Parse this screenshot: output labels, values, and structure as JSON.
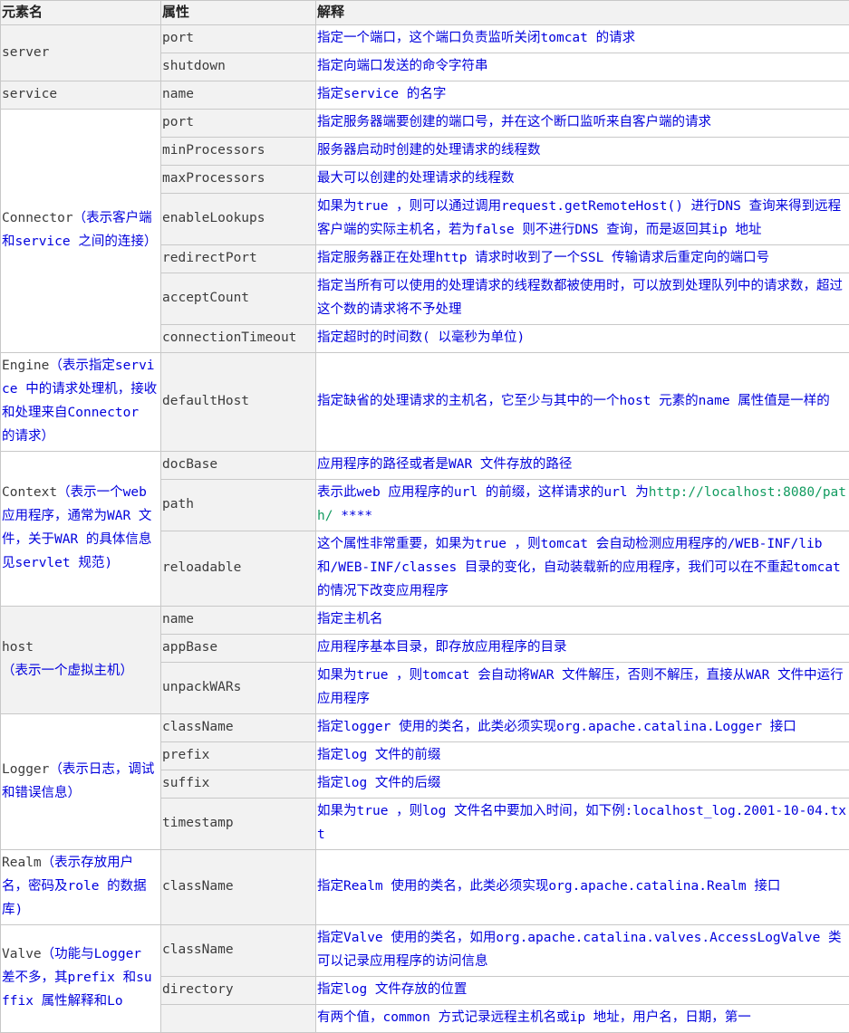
{
  "headers": [
    "元素名",
    "属性",
    "解释"
  ],
  "groups": [
    {
      "element_name": "server",
      "element_note": "",
      "shade": true,
      "rows": [
        {
          "attr": "port",
          "desc": [
            {
              "t": "指定一个端口，这个端口负责监听关闭tomcat 的请求"
            }
          ]
        },
        {
          "attr": "shutdown",
          "desc": [
            {
              "t": "指定向端口发送的命令字符串"
            }
          ]
        }
      ]
    },
    {
      "element_name": "service",
      "element_note": "",
      "shade": true,
      "rows": [
        {
          "attr": "name",
          "desc": [
            {
              "t": "指定service 的名字"
            }
          ]
        }
      ]
    },
    {
      "element_name": "Connector",
      "element_note": "（表示客户端和service 之间的连接）",
      "shade": false,
      "rows": [
        {
          "attr": "port",
          "desc": [
            {
              "t": "指定服务器端要创建的端口号，并在这个断口监听来自客户端的请求"
            }
          ]
        },
        {
          "attr": "minProcessors",
          "desc": [
            {
              "t": "服务器启动时创建的处理请求的线程数"
            }
          ]
        },
        {
          "attr": "maxProcessors",
          "desc": [
            {
              "t": "最大可以创建的处理请求的线程数"
            }
          ]
        },
        {
          "attr": "enableLookups",
          "desc": [
            {
              "t": "如果为true ，则可以通过调用request.getRemoteHost() 进行DNS 查询来得到远程客户端的实际主机名，若为false 则不进行DNS 查询，而是返回其ip 地址"
            }
          ]
        },
        {
          "attr": "redirectPort",
          "desc": [
            {
              "t": "指定服务器正在处理http 请求时收到了一个SSL 传输请求后重定向的端口号"
            }
          ]
        },
        {
          "attr": "acceptCount",
          "desc": [
            {
              "t": "指定当所有可以使用的处理请求的线程数都被使用时，可以放到处理队列中的请求数，超过这个数的请求将不予处理"
            }
          ]
        },
        {
          "attr": "connectionTimeout",
          "desc": [
            {
              "t": "指定超时的时间数( 以毫秒为单位)"
            }
          ]
        }
      ]
    },
    {
      "element_name": "Engine",
      "element_note": "（表示指定service 中的请求处理机，接收和处理来自Connector 的请求）",
      "shade": false,
      "rows": [
        {
          "attr": "defaultHost",
          "desc": [
            {
              "t": "指定缺省的处理请求的主机名，它至少与其中的一个host 元素的name 属性值是一样的"
            }
          ]
        }
      ]
    },
    {
      "element_name": "Context",
      "element_note": "（表示一个web 应用程序，通常为WAR 文件，关于WAR 的具体信息见servlet 规范)",
      "shade": false,
      "rows": [
        {
          "attr": "docBase",
          "desc": [
            {
              "t": "应用程序的路径或者是WAR 文件存放的路径"
            }
          ]
        },
        {
          "attr": "path",
          "desc": [
            {
              "t": "表示此web 应用程序的url 的前缀，这样请求的url 为"
            },
            {
              "t": "http://localhost:8080/path/",
              "link": true
            },
            {
              "t": " ****"
            }
          ]
        },
        {
          "attr": "reloadable",
          "desc": [
            {
              "t": "这个属性非常重要，如果为true ，则tomcat 会自动检测应用程序的/WEB-INF/lib 和/WEB-INF/classes 目录的变化，自动装载新的应用程序，我们可以在不重起tomcat 的情况下改变应用程序"
            }
          ]
        }
      ]
    },
    {
      "element_name": "host",
      "element_note": "（表示一个虚拟主机）",
      "shade": true,
      "rows": [
        {
          "attr": "name",
          "desc": [
            {
              "t": "指定主机名"
            }
          ]
        },
        {
          "attr": "appBase",
          "desc": [
            {
              "t": "应用程序基本目录，即存放应用程序的目录"
            }
          ]
        },
        {
          "attr": "unpackWARs",
          "desc": [
            {
              "t": "如果为true ，则tomcat 会自动将WAR 文件解压，否则不解压，直接从WAR 文件中运行应用程序"
            }
          ]
        }
      ]
    },
    {
      "element_name": "Logger",
      "element_note": "（表示日志，调试和错误信息）",
      "shade": false,
      "rows": [
        {
          "attr": "className",
          "desc": [
            {
              "t": "指定logger 使用的类名，此类必须实现org.apache.catalina.Logger 接口"
            }
          ]
        },
        {
          "attr": "prefix",
          "desc": [
            {
              "t": "指定log 文件的前缀"
            }
          ]
        },
        {
          "attr": "suffix",
          "desc": [
            {
              "t": "指定log 文件的后缀"
            }
          ]
        },
        {
          "attr": "timestamp",
          "desc": [
            {
              "t": "如果为true ，则log 文件名中要加入时间，如下例:localhost_log.2001-10-04.txt"
            }
          ]
        }
      ]
    },
    {
      "element_name": "Realm",
      "element_note": "（表示存放用户名，密码及role 的数据库)",
      "shade": false,
      "rows": [
        {
          "attr": "className",
          "desc": [
            {
              "t": "指定Realm 使用的类名，此类必须实现org.apache.catalina.Realm 接口"
            }
          ]
        }
      ]
    },
    {
      "element_name": "Valve",
      "element_note": "（功能与Logger 差不多，其prefix 和suffix 属性解释和Lo",
      "shade": false,
      "rows": [
        {
          "attr": "className",
          "desc": [
            {
              "t": "指定Valve 使用的类名，如用org.apache.catalina.valves.AccessLogValve 类可以记录应用程序的访问信息"
            }
          ]
        },
        {
          "attr": "directory",
          "desc": [
            {
              "t": "指定log 文件存放的位置"
            }
          ]
        },
        {
          "attr": "",
          "desc": [
            {
              "t": "有两个值，common 方式记录远程主机名或ip 地址，用户名，日期，第一"
            }
          ]
        }
      ]
    }
  ]
}
